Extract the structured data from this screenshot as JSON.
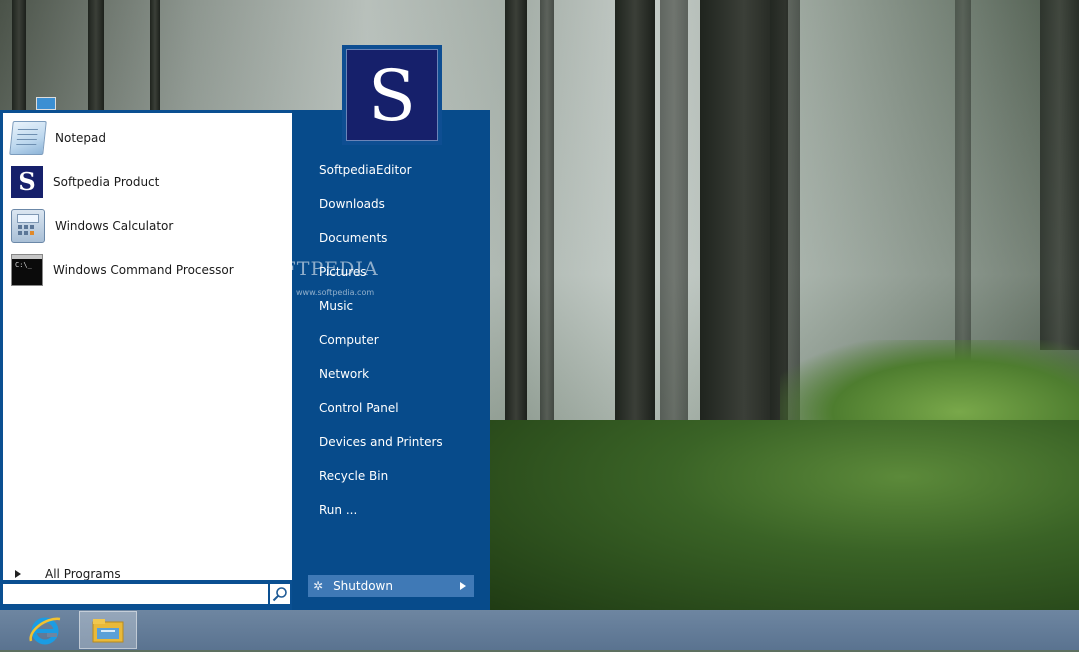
{
  "pinned_programs": [
    {
      "label": "Notepad",
      "icon": "notepad-icon"
    },
    {
      "label": "Softpedia Product",
      "icon": "softpedia-icon"
    },
    {
      "label": "Windows Calculator",
      "icon": "calculator-icon"
    },
    {
      "label": "Windows Command Processor",
      "icon": "command-prompt-icon"
    }
  ],
  "all_programs_label": "All Programs",
  "search": {
    "value": ""
  },
  "user": {
    "avatar_letter": "S"
  },
  "places": [
    "SoftpediaEditor",
    "Downloads",
    "Documents",
    "Pictures",
    "Music",
    "Computer",
    "Network",
    "Control Panel",
    "Devices and Printers",
    "Recycle Bin",
    "Run ..."
  ],
  "shutdown_label": "Shutdown",
  "watermark": {
    "brand": "SOFTPEDIA",
    "url": "www.softpedia.com"
  },
  "taskbar": {
    "items": [
      {
        "icon": "internet-explorer-icon"
      },
      {
        "icon": "file-explorer-icon"
      }
    ]
  },
  "colors": {
    "menu_blue": "#074b8b",
    "shutdown_blue": "#3f79b6"
  }
}
